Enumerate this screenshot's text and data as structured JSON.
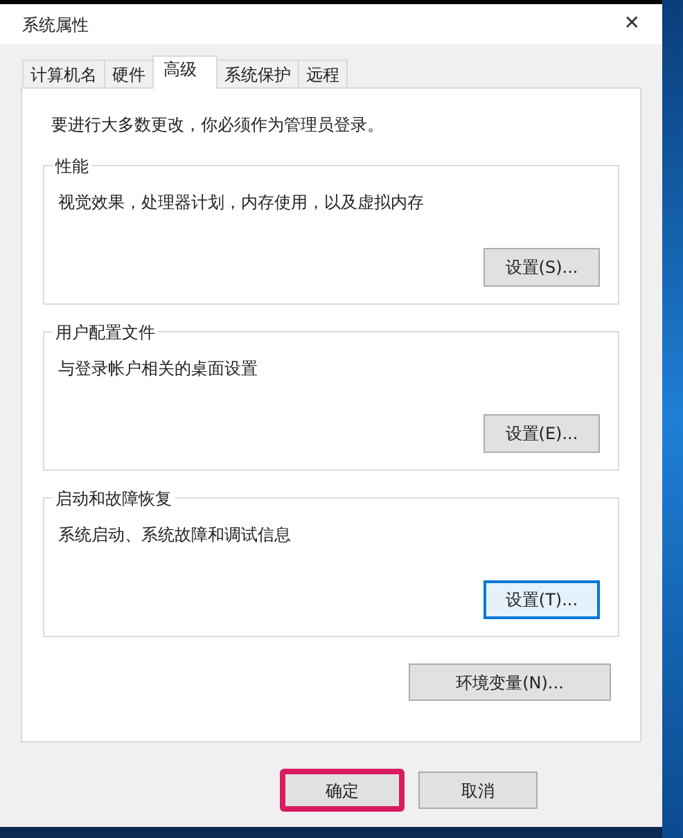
{
  "window": {
    "title": "系统属性",
    "close": "✕"
  },
  "tabs": [
    {
      "label": "计算机名",
      "selected": false
    },
    {
      "label": "硬件",
      "selected": false
    },
    {
      "label": "高级",
      "selected": true
    },
    {
      "label": "系统保护",
      "selected": false
    },
    {
      "label": "远程",
      "selected": false
    }
  ],
  "notice": "要进行大多数更改，你必须作为管理员登录。",
  "groups": [
    {
      "title": "性能",
      "description": "视觉效果，处理器计划，内存使用，以及虚拟内存",
      "button": {
        "label": "设置(S)...",
        "focused": false
      }
    },
    {
      "title": "用户配置文件",
      "description": "与登录帐户相关的桌面设置",
      "button": {
        "label": "设置(E)...",
        "focused": false
      }
    },
    {
      "title": "启动和故障恢复",
      "description": "系统启动、系统故障和调试信息",
      "button": {
        "label": "设置(T)...",
        "focused": true
      }
    }
  ],
  "env_button": "环境变量(N)...",
  "footer_buttons": [
    {
      "label": "确定",
      "highlighted": true
    },
    {
      "label": "取消",
      "highlighted": false
    }
  ]
}
